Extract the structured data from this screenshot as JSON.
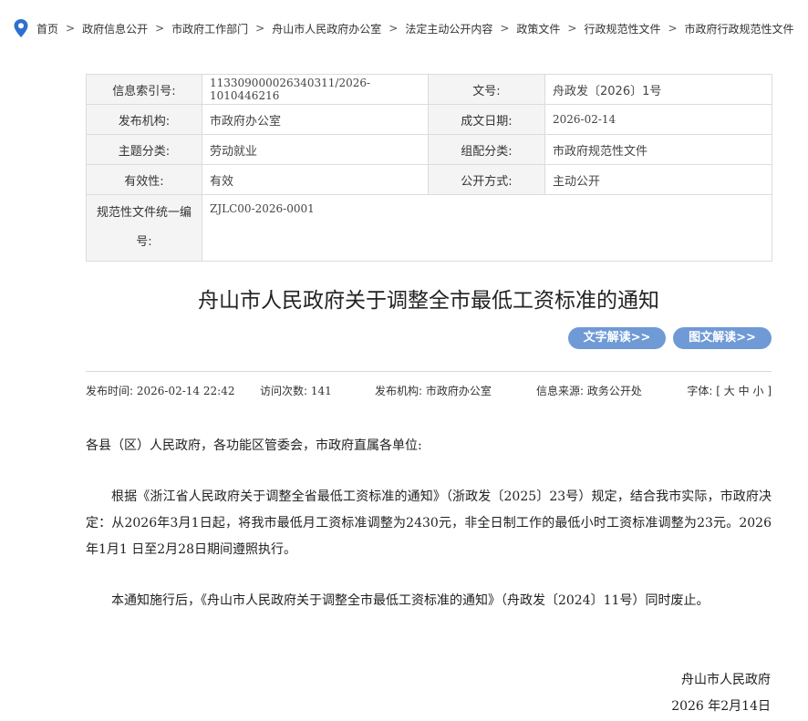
{
  "breadcrumb": {
    "items": [
      "首页",
      "政府信息公开",
      "市政府工作部门",
      "舟山市人民政府办公室",
      "法定主动公开内容",
      "政策文件",
      "行政规范性文件",
      "市政府行政规范性文件"
    ],
    "separator": ">"
  },
  "meta": {
    "index_label": "信息索引号:",
    "index_value": "113309000026340311/2026-1010446216",
    "docno_label": "文号:",
    "docno_value": "舟政发〔2026〕1号",
    "publisher_label": "发布机构:",
    "publisher_value": "市政府办公室",
    "date_label": "成文日期:",
    "date_value": "2026-02-14",
    "topic_label": "主题分类:",
    "topic_value": "劳动就业",
    "group_label": "组配分类:",
    "group_value": "市政府规范性文件",
    "validity_label": "有效性:",
    "validity_value": "有效",
    "method_label": "公开方式:",
    "method_value": "主动公开",
    "code_label": "规范性文件统一编号:",
    "code_value": "ZJLC00-2026-0001"
  },
  "title": "舟山市人民政府关于调整全市最低工资标准的通知",
  "buttons": {
    "text_interp": "文字解读>>",
    "graphic_interp": "图文解读>>"
  },
  "info": {
    "pub_time_label": "发布时间:",
    "pub_time": "2026-02-14 22:42",
    "visits_label": "访问次数:",
    "visits": "141",
    "org_label": "发布机构:",
    "org": "市政府办公室",
    "source_label": "信息来源:",
    "source": "政务公开处",
    "font_label": "字体:",
    "font_open": "[",
    "font_large": "大",
    "font_medium": "中",
    "font_small": "小",
    "font_close": "]"
  },
  "content": {
    "salutation": "各县（区）人民政府，各功能区管委会，市政府直属各单位:",
    "para1": "根据《浙江省人民政府关于调整全省最低工资标准的通知》（浙政发〔2025〕23号）规定，结合我市实际，市政府决定：从2026年3月1日起，将我市最低月工资标准调整为2430元，非全日制工作的最低小时工资标准调整为23元。2026年1月1 日至2月28日期间遵照执行。",
    "para2": "本通知施行后，《舟山市人民政府关于调整全市最低工资标准的通知》（舟政发〔2024〕11号）同时废止。",
    "sign_org": "舟山市人民政府",
    "sign_date": "2026 年2月14日"
  },
  "colors": {
    "pin": "#2f6fcf",
    "button": "#6f9ad6",
    "table_border": "#dcdcdc",
    "table_key_bg": "#f4f4f4"
  }
}
